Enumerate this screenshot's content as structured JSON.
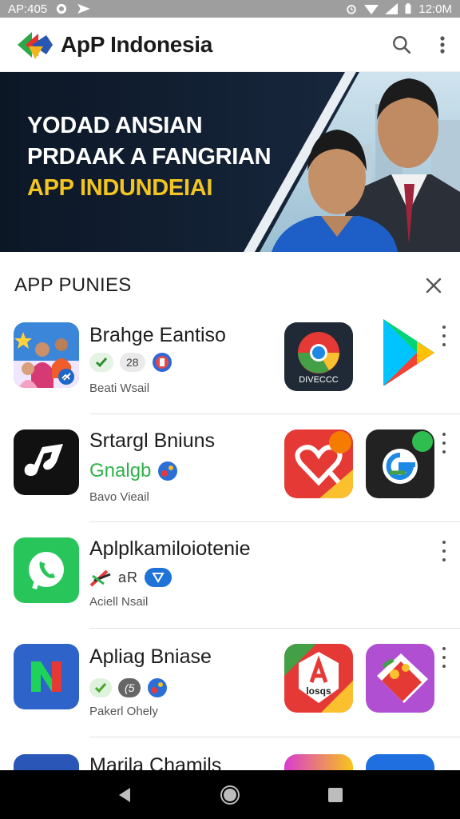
{
  "status_bar": {
    "left_text": "AP:405",
    "time": "12:0M"
  },
  "app_bar": {
    "title": "ApP Indonesia",
    "search_icon": "search-icon",
    "menu_icon": "more-vert-icon"
  },
  "banner": {
    "line1": "YODAD ANSIAN",
    "line2": "PRDAAK A FANGRIAN",
    "line3": "APP INDUNDEIAI"
  },
  "section": {
    "title": "APP PUNIES",
    "close_icon": "close-icon",
    "rows": [
      {
        "name": "Brahge Eantiso",
        "chips": [
          "",
          "28",
          ""
        ],
        "sub": "Beati Wsail",
        "side_icons": [
          "browser-icon",
          "play-store-icon"
        ],
        "side_icon_label": "DIVECCC"
      },
      {
        "name": "Srtargl Bniuns",
        "chips": [
          "Gnalgb",
          ""
        ],
        "sub": "Bavo Vieail",
        "side_icons": [
          "heart-app-icon",
          "g-app-icon"
        ]
      },
      {
        "name": "Aplplkamiloiotenie",
        "chips": [
          "",
          "aR",
          ""
        ],
        "sub": "Aciell Nsail",
        "side_icons": []
      },
      {
        "name": "Apliag Bniase",
        "chips": [
          "",
          "(5",
          ""
        ],
        "sub": "Pakerl Ohely",
        "side_icons": [
          "a-app-icon",
          "sticker-app-icon"
        ],
        "side_icon_label": "losqs"
      },
      {
        "name": "Marila Chamils",
        "chips": [],
        "sub": "",
        "side_icons": [
          "colorful-app-icon",
          "blue-app-icon"
        ]
      }
    ]
  },
  "nav": {
    "back": "back-icon",
    "home": "home-icon",
    "recents": "recents-icon"
  },
  "colors": {
    "banner_bg": "#0e1a2c",
    "highlight": "#f2c522",
    "green": "#2fb24c",
    "status_bar": "#9e9e9e"
  }
}
